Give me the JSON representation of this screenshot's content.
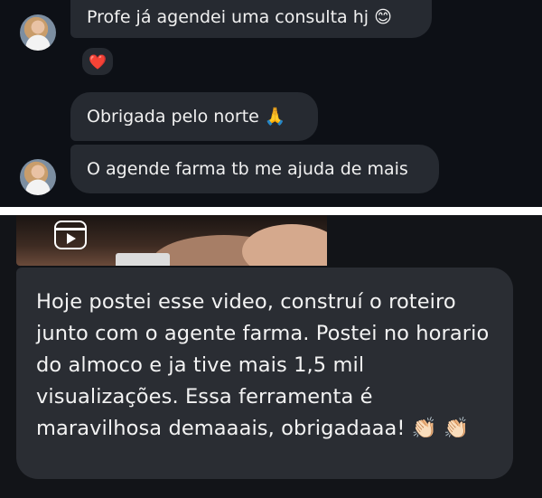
{
  "top_chat": {
    "messages": [
      {
        "text": "Profe já agendei uma consulta hj 😊",
        "reaction": "❤️"
      },
      {
        "text": "Obrigada pelo norte 🙏"
      },
      {
        "text": "O agende farma tb me ajuda de mais"
      }
    ]
  },
  "bottom_chat": {
    "message": "Hoje postei esse video, construí o roteiro junto com o agente farma. Postei no horario do almoco e ja tive mais 1,5 mil visualizações. Essa ferramenta é maravilhosa demaaais, obrigadaaa! 👏🏻 👏🏻",
    "attachment_icon": "reels-icon"
  }
}
